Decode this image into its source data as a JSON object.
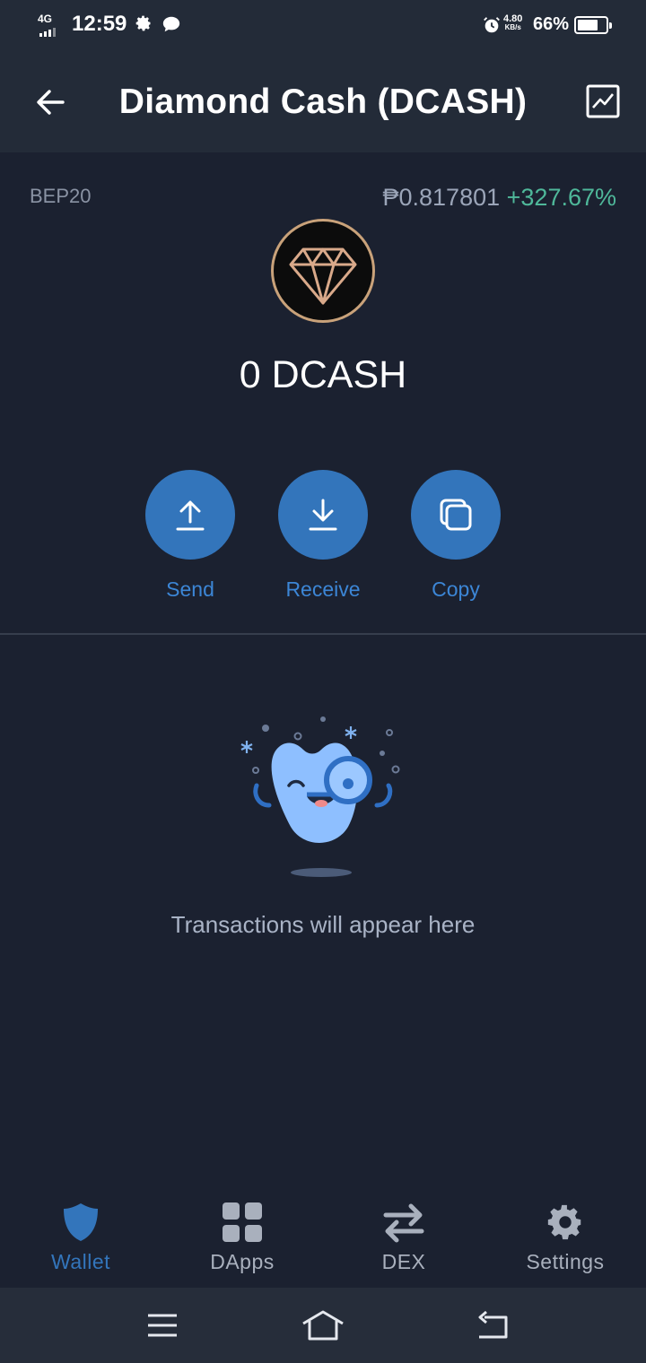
{
  "status_bar": {
    "network": "4G",
    "time": "12:59",
    "speed_value": "4.80",
    "speed_unit": "KB/s",
    "battery": "66%"
  },
  "header": {
    "title": "Diamond Cash (DCASH)",
    "back_icon": "arrow-left-icon",
    "chart_icon": "line-chart-icon"
  },
  "token": {
    "network": "BEP20",
    "price": "₱0.817801",
    "change": "+327.67%",
    "balance": "0 DCASH",
    "logo_icon": "diamond-icon"
  },
  "actions": [
    {
      "label": "Send",
      "icon": "upload-arrow-icon"
    },
    {
      "label": "Receive",
      "icon": "download-arrow-icon"
    },
    {
      "label": "Copy",
      "icon": "copy-icon"
    }
  ],
  "empty_state": {
    "message": "Transactions will appear here"
  },
  "tabs": [
    {
      "label": "Wallet",
      "icon": "shield-icon",
      "active": true
    },
    {
      "label": "DApps",
      "icon": "grid-icon",
      "active": false
    },
    {
      "label": "DEX",
      "icon": "swap-arrows-icon",
      "active": false
    },
    {
      "label": "Settings",
      "icon": "gear-icon",
      "active": false
    }
  ],
  "colors": {
    "background": "#1b2130",
    "header": "#232b38",
    "accent": "#3375bb",
    "positive": "#4fb89a"
  }
}
